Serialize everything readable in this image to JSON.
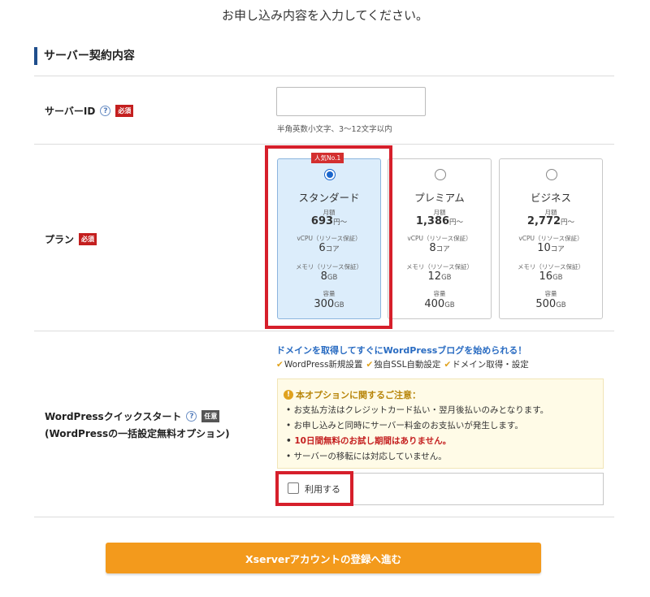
{
  "heading": "お申し込み内容を入力してください。",
  "section_title": "サーバー契約内容",
  "server_id": {
    "label": "サーバーID",
    "help": "?",
    "required": "必須",
    "value": "",
    "hint": "半角英数小文字、3～12文字以内"
  },
  "plan": {
    "label": "プラン",
    "required": "必須",
    "popular_badge": "人気No.1",
    "price_label": "月額",
    "price_unit": "円～",
    "cpu_label": "vCPU（リソース保証）",
    "cpu_unit": "コア",
    "mem_label": "メモリ（リソース保証）",
    "mem_unit": "GB",
    "disk_label": "容量",
    "disk_unit": "GB",
    "options": [
      {
        "name": "スタンダード",
        "price": "693",
        "cpu": "6",
        "mem": "8",
        "disk": "300",
        "selected": true
      },
      {
        "name": "プレミアム",
        "price": "1,386",
        "cpu": "8",
        "mem": "12",
        "disk": "400",
        "selected": false
      },
      {
        "name": "ビジネス",
        "price": "2,772",
        "cpu": "10",
        "mem": "16",
        "disk": "500",
        "selected": false
      }
    ]
  },
  "wp": {
    "label_line1": "WordPressクイックスタート",
    "label_line2": "(WordPressの一括設定無料オプション)",
    "help": "?",
    "optional": "任意",
    "promo": "ドメインを取得してすぐにWordPressブログを始められる！",
    "features": [
      "WordPress新規設置",
      "独自SSL自動設定",
      "ドメイン取得・設定"
    ],
    "notice_title": "本オプションに関するご注意：",
    "notice_icon": "!",
    "notices": [
      "お支払方法はクレジットカード払い・翌月後払いのみとなります。",
      "お申し込みと同時にサーバー料金のお支払いが発生します。",
      "10日間無料のお試し期間はありません。",
      "サーバーの移転には対応していません。"
    ],
    "use_label": "利用する"
  },
  "submit_label": "Xserverアカウントの登録へ進む",
  "colors": {
    "accent_blue": "#1f4e8c",
    "highlight_red": "#d61f2b",
    "button_orange": "#f39a1c",
    "selected_plan_bg": "#dcedfb"
  }
}
